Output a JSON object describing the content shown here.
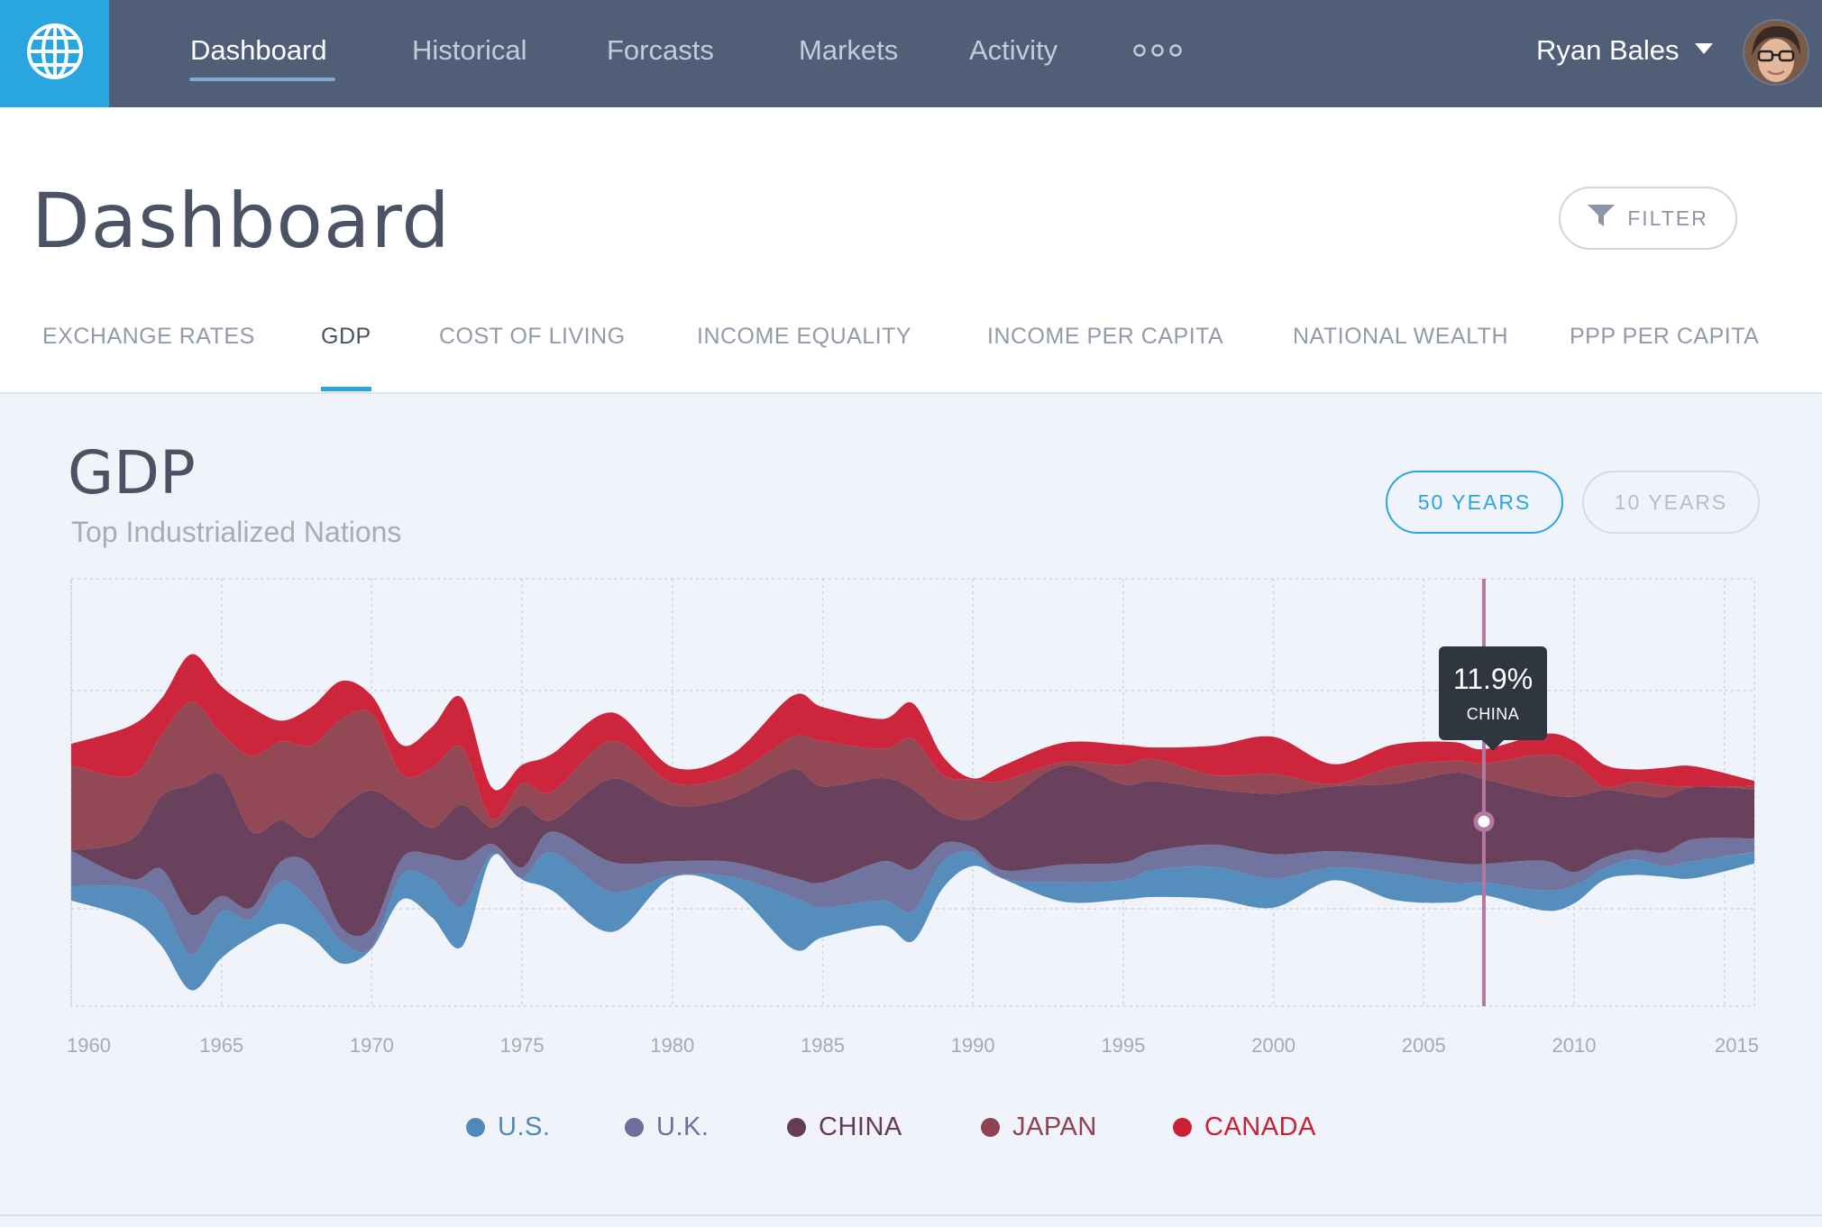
{
  "nav": {
    "items": [
      {
        "label": "Dashboard",
        "active": true
      },
      {
        "label": "Historical"
      },
      {
        "label": "Forcasts"
      },
      {
        "label": "Markets"
      },
      {
        "label": "Activity"
      }
    ],
    "more_icon": "more-dots-icon",
    "user_name": "Ryan Bales",
    "logo_icon": "globe-icon"
  },
  "header": {
    "title": "Dashboard",
    "filter_label": "FILTER",
    "filter_icon": "funnel-icon",
    "tabs": [
      {
        "label": "EXCHANGE RATES"
      },
      {
        "label": "GDP",
        "active": true
      },
      {
        "label": "COST OF LIVING"
      },
      {
        "label": "INCOME EQUALITY"
      },
      {
        "label": "INCOME PER CAPITA"
      },
      {
        "label": "NATIONAL WEALTH"
      },
      {
        "label": "PPP PER CAPITA"
      }
    ]
  },
  "chart_card": {
    "title": "GDP",
    "subtitle": "Top Industrialized Nations",
    "range_buttons": [
      {
        "label": "50 YEARS",
        "active": true
      },
      {
        "label": "10 YEARS"
      }
    ],
    "tooltip": {
      "value": "11.9%",
      "label": "CHINA"
    }
  },
  "chart_data": {
    "type": "area",
    "subtype": "streamgraph",
    "title": "GDP",
    "subtitle": "Top Industrialized Nations",
    "x_tick_labels": [
      "1960",
      "1965",
      "1970",
      "1975",
      "1980",
      "1985",
      "1990",
      "1995",
      "2000",
      "2005",
      "2010",
      "2015"
    ],
    "xlim": [
      1960,
      2016
    ],
    "grid": true,
    "legend_position": "bottom",
    "x": [
      1960,
      1962,
      1963,
      1964,
      1965,
      1966,
      1967,
      1968,
      1969,
      1970,
      1971,
      1972,
      1973,
      1974,
      1975,
      1976,
      1978,
      1980,
      1982,
      1984,
      1985,
      1987,
      1988,
      1989,
      1990,
      1991,
      1993,
      1995,
      1996,
      1998,
      2000,
      2002,
      2004,
      2006,
      2007,
      2009,
      2010,
      2011,
      2012,
      2013,
      2014,
      2016
    ],
    "series": [
      {
        "name": "U.S.",
        "color": "#4f89bb",
        "values": [
          2.0,
          4.5,
          6.0,
          5.0,
          6.5,
          2.5,
          6.0,
          4.9,
          3.1,
          0.2,
          3.4,
          5.3,
          5.6,
          -0.5,
          -0.2,
          5.4,
          5.6,
          -0.3,
          -1.9,
          7.3,
          4.2,
          3.5,
          4.2,
          3.7,
          1.9,
          -0.1,
          2.7,
          2.7,
          3.8,
          4.5,
          4.1,
          1.8,
          3.8,
          2.7,
          1.8,
          -2.8,
          2.5,
          1.6,
          2.2,
          1.5,
          2.4,
          1.6
        ]
      },
      {
        "name": "U.K.",
        "color": "#6c6f9c",
        "values": [
          5.0,
          1.1,
          4.8,
          5.6,
          2.2,
          1.6,
          2.8,
          5.1,
          1.9,
          2.7,
          2.4,
          3.5,
          6.5,
          -1.3,
          -1.5,
          2.9,
          4.2,
          -2.0,
          2.1,
          2.7,
          3.5,
          5.5,
          5.9,
          2.6,
          0.7,
          -1.1,
          2.5,
          2.5,
          2.6,
          3.1,
          3.4,
          2.3,
          2.4,
          2.8,
          2.6,
          -4.2,
          1.9,
          1.5,
          1.3,
          1.9,
          3.1,
          1.9
        ]
      },
      {
        "name": "CHINA",
        "color": "#643b58",
        "values": [
          0.0,
          -5.6,
          10.2,
          18.2,
          17.0,
          10.7,
          -5.7,
          -4.1,
          16.9,
          19.3,
          7.1,
          3.8,
          7.8,
          2.3,
          8.7,
          -1.6,
          11.7,
          7.8,
          9.0,
          15.2,
          13.5,
          11.7,
          11.2,
          4.2,
          3.9,
          9.3,
          13.9,
          11.0,
          9.9,
          7.8,
          8.5,
          9.1,
          10.1,
          12.7,
          11.9,
          9.4,
          10.6,
          9.5,
          7.9,
          7.8,
          7.3,
          6.9
        ]
      },
      {
        "name": "JAPAN",
        "color": "#8f4250",
        "values": [
          12.0,
          8.9,
          8.5,
          11.7,
          5.8,
          10.6,
          11.1,
          12.9,
          12.5,
          10.7,
          4.7,
          8.4,
          8.0,
          -1.2,
          3.1,
          4.0,
          5.3,
          3.2,
          3.3,
          4.5,
          6.3,
          4.1,
          7.1,
          5.4,
          5.6,
          3.3,
          -0.5,
          2.7,
          3.1,
          -2.0,
          2.8,
          0.3,
          2.4,
          1.7,
          2.2,
          -5.5,
          4.7,
          -0.5,
          1.7,
          1.6,
          0.0,
          0.5
        ]
      },
      {
        "name": "CANADA",
        "color": "#cb1f36",
        "values": [
          3.0,
          7.1,
          5.2,
          6.7,
          6.6,
          6.8,
          2.9,
          5.4,
          5.3,
          2.6,
          4.1,
          5.7,
          7.0,
          4.4,
          2.6,
          5.3,
          4.0,
          2.2,
          -2.9,
          5.8,
          4.8,
          4.2,
          5.0,
          2.6,
          0.2,
          -2.1,
          2.7,
          2.8,
          1.6,
          4.1,
          5.2,
          2.8,
          3.1,
          2.6,
          2.0,
          -2.9,
          3.1,
          3.1,
          1.7,
          2.5,
          2.9,
          0.7
        ]
      }
    ],
    "cursor": {
      "x": 2007,
      "series": "CHINA",
      "value": "11.9%"
    }
  }
}
